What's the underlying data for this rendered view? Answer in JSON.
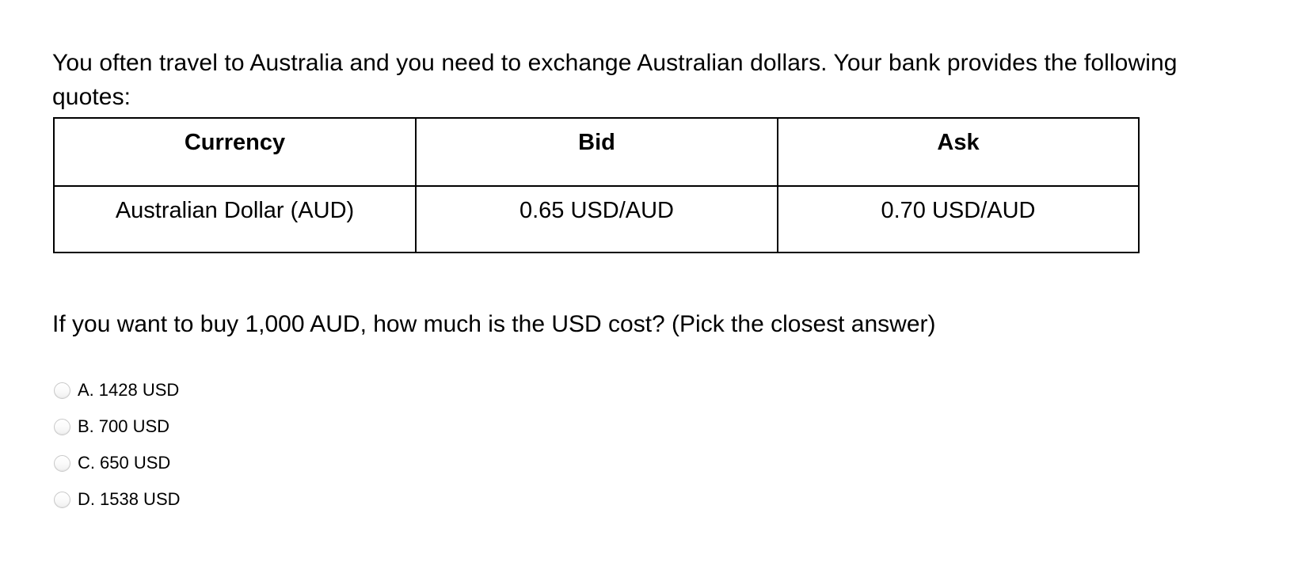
{
  "intro": {
    "paragraph": "You often travel to Australia and you need to exchange Australian dollars. Your bank provides the following quotes:"
  },
  "quotes_table": {
    "headers": [
      "Currency",
      "Bid",
      "Ask"
    ],
    "rows": [
      {
        "currency": "Australian Dollar (AUD)",
        "bid": "0.65 USD/AUD",
        "ask": "0.70 USD/AUD"
      }
    ]
  },
  "question": {
    "text": "If you want to buy 1,000 AUD, how much is the USD cost? (Pick the closest answer)"
  },
  "options": [
    {
      "letter": "A.",
      "text": "1428 USD",
      "selected": false
    },
    {
      "letter": "B.",
      "text": "700 USD",
      "selected": false
    },
    {
      "letter": "C.",
      "text": "650 USD",
      "selected": false
    },
    {
      "letter": "D.",
      "text": "1538 USD",
      "selected": false
    }
  ],
  "colors": {
    "text": "#000000",
    "background": "#ffffff",
    "table_border": "#000000",
    "radio_border": "#c9c9c9"
  }
}
